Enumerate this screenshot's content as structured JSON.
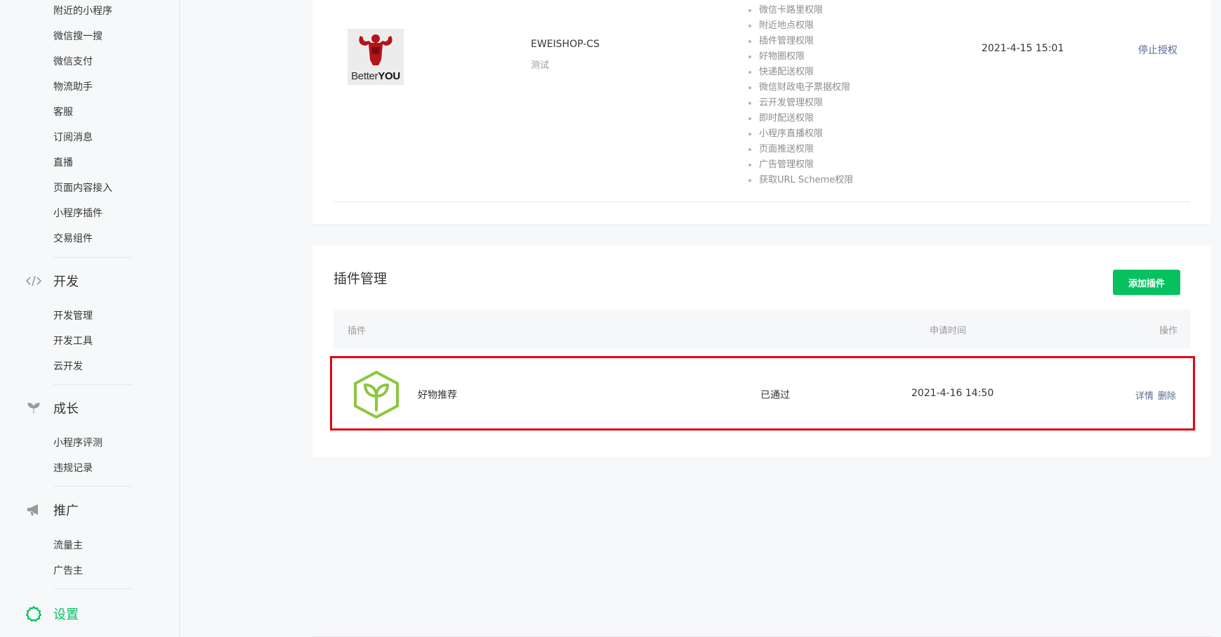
{
  "sidebar": {
    "items_top": [
      "附近的小程序",
      "微信搜一搜",
      "微信支付",
      "物流助手",
      "客服",
      "订阅消息",
      "直播",
      "页面内容接入",
      "小程序插件",
      "交易组件"
    ],
    "groups": [
      {
        "icon": "code-icon",
        "label": "开发",
        "items": [
          "开发管理",
          "开发工具",
          "云开发"
        ]
      },
      {
        "icon": "sprout-icon",
        "label": "成长",
        "items": [
          "小程序评测",
          "违规记录"
        ]
      },
      {
        "icon": "megaphone-icon",
        "label": "推广",
        "items": [
          "流量主",
          "广告主"
        ]
      },
      {
        "icon": "gear-icon",
        "label": "设置",
        "items": [],
        "active": true
      }
    ],
    "accent": "#07c160"
  },
  "authorized_app": {
    "logo_text": "BetterYOU",
    "logo_text_a": "Better",
    "logo_text_b": "YOU",
    "name": "EWEISHOP-CS",
    "desc": "测试",
    "permissions": [
      "微信卡路里权限",
      "附近地点权限",
      "插件管理权限",
      "好物圈权限",
      "快递配送权限",
      "微信财政电子票据权限",
      "云开发管理权限",
      "即时配送权限",
      "小程序直播权限",
      "页面推送权限",
      "广告管理权限",
      "获取URL Scheme权限"
    ],
    "time": "2021-4-15 15:01",
    "action": "停止授权"
  },
  "plugin_section": {
    "title": "插件管理",
    "add_button": "添加插件",
    "columns": {
      "plugin": "插件",
      "apply_time": "申请时间",
      "operation": "操作"
    },
    "rows": [
      {
        "icon": "sprout-box-icon",
        "name": "好物推荐",
        "status": "已通过",
        "time": "2021-4-16 14:50",
        "actions": [
          "详情",
          "删除"
        ]
      }
    ],
    "highlight_color": "#e30613",
    "link_color": "#576b95"
  }
}
